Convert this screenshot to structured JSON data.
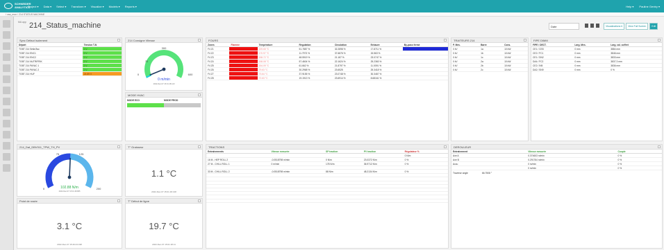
{
  "topbar": {
    "logo_text": "SCHNEIDER ANALYTICS",
    "nav": [
      "Project ▾",
      "Data ▾",
      "Select ▾",
      "Transform ▾",
      "Visualize ▾",
      "Models ▾",
      "Reports ▾"
    ],
    "help": "Help ▾",
    "user": "Pauline Gentry ▾"
  },
  "breadcrumb": "/ csa_mon / 214 STATUS MACHINE",
  "header": {
    "subtitle": "MA app",
    "title": "214_Status_machine",
    "date": "Date",
    "btn_visualize": "Visualizations ▾",
    "btn_fullscreen": "View Full Screen",
    "btn_edit": "Edit"
  },
  "colors": {
    "brand": "#1fa3ad",
    "ok": "#5de04a",
    "warn": "#f59a23",
    "alarm": "#ee1111",
    "bar_blue": "#1f2ad6",
    "gauge_cyan": "#1bd3e0",
    "gauge_green": "#56e37a",
    "gauge_blue": "#2a48e0"
  },
  "sync": {
    "title": "Sync Défaut Isolement",
    "headers": [
      "Départ",
      "Tension T-N"
    ],
    "rows": [
      [
        "TGBT 214 Sella Bsc",
        "0 V",
        "g"
      ],
      [
        "TGBT 214 ENC1",
        "0 V",
        "g"
      ],
      [
        "TGBT 214 ENC2",
        "0 V",
        "g"
      ],
      [
        "TGBT 214 NUTRIFRIK",
        "0 V",
        "g"
      ],
      [
        "TGBT 214 PAYAC 1",
        "0 V",
        "g"
      ],
      [
        "TGBT 214 PAYAC 2",
        "0 V",
        "g"
      ],
      [
        "TGBT 214 HUF",
        "24.89 V",
        "o"
      ]
    ]
  },
  "vitesse": {
    "title": "214 Consigne Vitesse",
    "value": "0 m/min",
    "min": "0",
    "max": "600",
    "tick_mid": "300",
    "tick_low": "70",
    "ts": "2022-Dec-07 15:01 48.123",
    "fill_pct": 2
  },
  "hvac": {
    "title": "MODE HVAC",
    "col1": "MODE ECO",
    "col2": "MODE PROD"
  },
  "fours": {
    "title": "FOURS",
    "headers": [
      "Zones",
      "Flamme",
      "Température",
      "Régulation",
      "Circulation",
      "Exhaure",
      "By-pass fermé"
    ],
    "rows": [
      [
        "F4 Z1",
        "",
        "229.65 °C",
        "51.7887 %",
        "32.2898 %",
        "17.8711 %"
      ],
      [
        "F4 Z2",
        "",
        "170.97 °C",
        "11.7973 %",
        "37.6876 %",
        "15.563 %"
      ],
      [
        "F4 Z3",
        "",
        "158.72 °C",
        "48.5919 %",
        "21.187 %",
        "23.0747 %"
      ],
      [
        "F4 Z4",
        "",
        "158.08 °C",
        "57.4604 %",
        "22.1624 %",
        "25.2363 %"
      ],
      [
        "F4 Z5",
        "",
        "154.09 °C",
        "61.662 %",
        "21.8797 %",
        "11.0091 %"
      ],
      [
        "F4 Z6",
        "",
        "79.63 °C",
        "30.2968 %",
        "23.6525",
        "25.3418 %"
      ],
      [
        "F4 Z7",
        "",
        "73.64 °C",
        "37.9155 %",
        "23.0748 %",
        "30.3467 %"
      ],
      [
        "F4 Z8",
        "",
        "72.63 °C",
        "19.1913 %",
        "23.6914 %",
        "8.68161 %"
      ]
    ]
  },
  "traiteurs": {
    "title": "TRAITEURS 214",
    "headers": [
      "P. Mes.",
      "Barre",
      "Cons."
    ],
    "rows": [
      [
        "0 kV",
        "1a",
        "10 kW"
      ],
      [
        "0 kV",
        "1b",
        "10 kW"
      ],
      [
        "0 kV",
        "1c",
        "10 kW"
      ],
      [
        "0 kV",
        "2a",
        "10 kW"
      ],
      [
        "0 kV",
        "2b",
        "10 kW"
      ],
      [
        "0 kV",
        "2c",
        "10 kW"
      ]
    ]
  },
  "fipe": {
    "title": "FIPE DIMM",
    "headers": [
      "FIPE / DECT.",
      "Larg. Mes.",
      "Larg. cal. coffret"
    ],
    "rows": [
      [
        "CE1 / CE8",
        "0 mm",
        "3884 mm"
      ],
      [
        "CE2 / FC1",
        "0 mm",
        "3846 mm"
      ],
      [
        "CE1 / DN2",
        "0 mm",
        "3833 mm"
      ],
      [
        "DA4 / FC2",
        "0 mm",
        "3837.3 mm"
      ],
      [
        "CE2 / IN5",
        "0 mm",
        "3836 mm"
      ],
      [
        "DA2 / SN9",
        "0 mm",
        "0 %"
      ]
    ]
  },
  "gauge2": {
    "title": "214_Dat_DBV011_TPW_TH_PV",
    "value": "102.88 N/m",
    "min": "0",
    "max": "200",
    "t25": "75",
    "t125": "125",
    "ts": "2022-Dec-07 15:01 48.865",
    "fill_pct": 51
  },
  "grafeur": {
    "title": "T° Graisseur",
    "value": "1.1 °C",
    "ts": "2022-Dec-07 15:01 48.138"
  },
  "rosee": {
    "title": "Point de rosée",
    "value": "3.1 °C",
    "ts": "2022-Dec-07 15:49:43.198"
  },
  "debut": {
    "title": "T° Début de ligne",
    "value": "19.7 °C",
    "ts": "2022-Dec-07 15:01 28.11"
  },
  "tractions": {
    "title": "TRACTIONS",
    "headers": [
      "Entraînements",
      "Vitesse mesurée",
      "SP traction",
      "PV traction",
      "Régulateur %"
    ],
    "rows": [
      [
        "",
        "",
        "",
        "",
        "0 N/m"
      ],
      [
        "16 M - HEP ROLL 2",
        "-0.0518798 m/min",
        "0 N/m",
        "23.0372 N/m",
        "0 %"
      ],
      [
        "27 M - CHILL ROLL 1",
        "0 m/min",
        "178 N/m",
        "36.9712 N/m",
        "0 %"
      ],
      [
        "",
        "",
        " ",
        "",
        ""
      ],
      [
        "33 M - CHILL ROLL 2",
        "-0.0518798 m/min",
        "88 N/m",
        "48.2134 N/m",
        "0 %"
      ]
    ]
  },
  "deroul": {
    "title": "DEROULEUR",
    "headers": [
      "Entraînement",
      "Vitesse mesurée",
      "Couple"
    ],
    "rows": [
      [
        "Axe A",
        "0.374603 m/min",
        "0 %"
      ],
      [
        "Axe B",
        "0.291764 m/min",
        "0 %"
      ],
      [
        "Accu",
        "0 m/min",
        "0 %"
      ],
      [
        "",
        "0 m/min",
        "0 %"
      ]
    ],
    "angle_label": "Traverse angle",
    "angle_val": "66.7508 °"
  }
}
